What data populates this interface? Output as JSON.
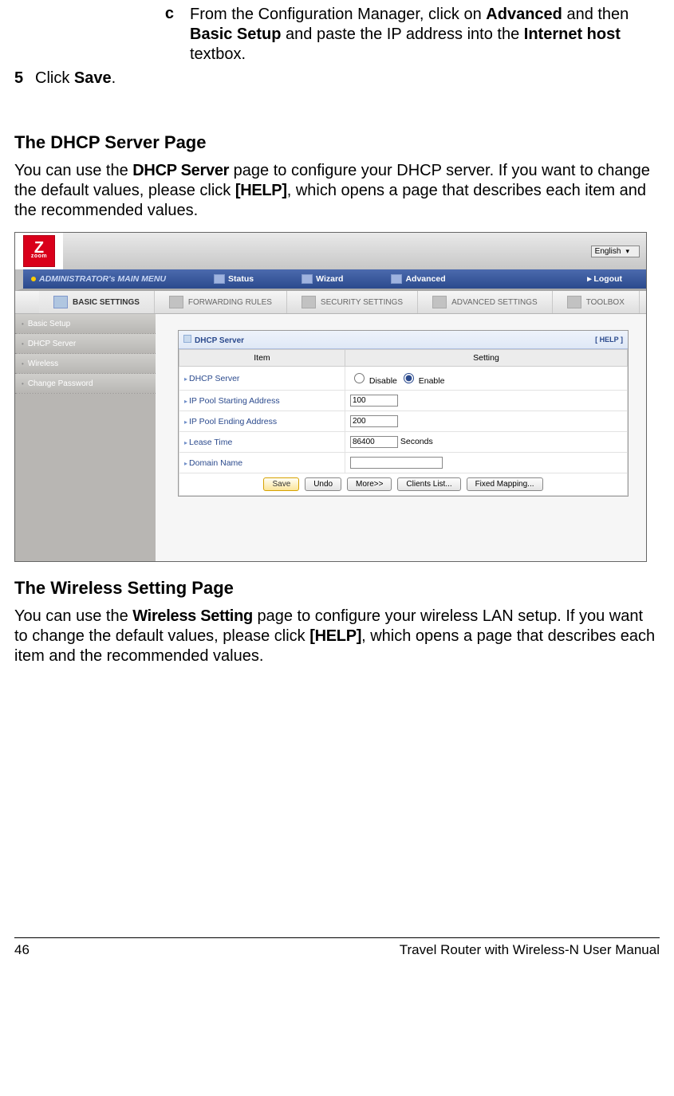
{
  "step_c_marker": "c",
  "step_c_text_pre": "From the Configuration Manager, click on ",
  "step_c_bold1": "Advanced",
  "step_c_mid1": " and then ",
  "step_c_bold2": "Basic Setup",
  "step_c_mid2": " and paste the IP address into the ",
  "step_c_bold3": "Internet host",
  "step_c_end": " textbox.",
  "step_5_marker": "5",
  "step_5_pre": "Click ",
  "step_5_bold": "Save",
  "step_5_end": ".",
  "sec_dhcp_title": "The DHCP Server Page",
  "dhcp_para_pre": "You can use the ",
  "dhcp_para_b1": "DHCP Server",
  "dhcp_para_mid": " page to configure your DHCP server. If you want to change the default values, please click ",
  "dhcp_para_b2": "[HELP]",
  "dhcp_para_end": ", which opens a page that describes each item and the recommended values.",
  "router": {
    "language": "English",
    "main_menu": "ADMINISTRATOR's MAIN MENU",
    "nav_status": "Status",
    "nav_wizard": "Wizard",
    "nav_advanced": "Advanced",
    "nav_logout": "▸ Logout",
    "tab_basic": "BASIC SETTINGS",
    "tab_forwarding": "FORWARDING RULES",
    "tab_security": "SECURITY SETTINGS",
    "tab_advsettings": "ADVANCED SETTINGS",
    "tab_toolbox": "TOOLBOX",
    "side_basic": "Basic Setup",
    "side_dhcp": "DHCP Server",
    "side_wireless": "Wireless",
    "side_change": "Change Password",
    "panel_title": "DHCP Server",
    "help": "[ HELP ]",
    "col_item": "Item",
    "col_setting": "Setting",
    "row_dhcp": "DHCP Server",
    "row_start": "IP Pool Starting Address",
    "row_end": "IP Pool Ending Address",
    "row_lease": "Lease Time",
    "row_domain": "Domain Name",
    "disable": "Disable",
    "enable": "Enable",
    "val_start": "100",
    "val_end": "200",
    "val_lease": "86400",
    "seconds": "Seconds",
    "btn_save": "Save",
    "btn_undo": "Undo",
    "btn_more": "More>>",
    "btn_clients": "Clients List...",
    "btn_fixed": "Fixed Mapping..."
  },
  "sec_wireless_title": "The Wireless Setting Page",
  "wireless_para_pre": "You can use the ",
  "wireless_para_b1": "Wireless Setting",
  "wireless_para_mid": " page to configure your wireless LAN setup. If you want to change the default values, please click ",
  "wireless_para_b2": "[HELP]",
  "wireless_para_end": ", which opens a page that describes each item and the recommended values.",
  "footer_page": "46",
  "footer_title": "Travel Router with Wireless-N User Manual"
}
